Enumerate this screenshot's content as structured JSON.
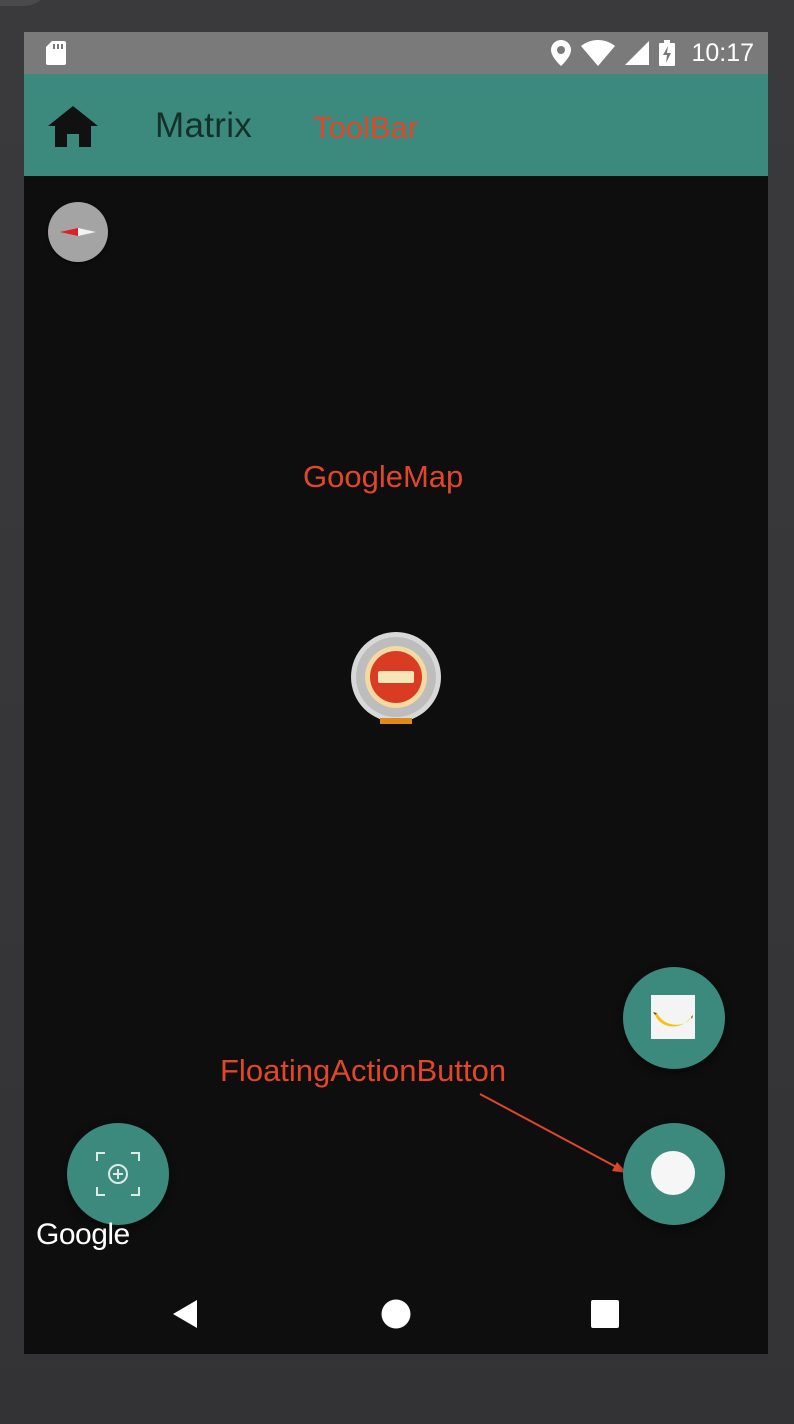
{
  "status_bar": {
    "time": "10:17",
    "icons": [
      "sd-card-icon",
      "location-icon",
      "wifi-icon",
      "signal-icon",
      "battery-charging-icon"
    ]
  },
  "toolbar": {
    "title": "Matrix",
    "annotation": "ToolBar",
    "nav_icon": "home-icon"
  },
  "map": {
    "annotation": "GoogleMap",
    "compass_icon": "compass-icon",
    "marker_icon": "no-entry-marker-icon",
    "attribution": "Google"
  },
  "floating_action_buttons": {
    "annotation": "FloatingActionButton",
    "items": [
      {
        "icon": "banana-icon"
      },
      {
        "icon": "record-icon"
      },
      {
        "icon": "my-location-icon"
      }
    ]
  },
  "nav_bar": {
    "items": [
      "back-icon",
      "home-circle-icon",
      "recents-icon"
    ]
  },
  "colors": {
    "primary": "#3c8a7d",
    "annotation": "#e0472a",
    "map_background": "#0e0e0e",
    "status_bar": "#7a7a7a"
  }
}
